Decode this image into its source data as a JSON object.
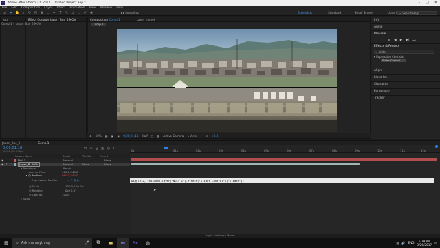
{
  "window": {
    "title": "Adobe After Effects CC 2017 - Untitled Project.aep *",
    "app_icon": "Ae"
  },
  "menu": [
    "File",
    "Edit",
    "Composition",
    "Layer",
    "Effect",
    "Animation",
    "View",
    "Window",
    "Help"
  ],
  "toolbar": {
    "snapping_label": "Snapping"
  },
  "workspaces": [
    "Essentials",
    "Standard",
    "Small Screen",
    "Libraries"
  ],
  "search_help": {
    "placeholder": "Search Help"
  },
  "left_panel": {
    "tab_project": "ject",
    "tab_effect_controls": "Effect Controls",
    "effect_controls_file": "Japan_Bus_6.MOV",
    "breadcrumb": "Comp 1 • Japan_Bus_6.MOV"
  },
  "comp_panel": {
    "tab_composition": "Composition",
    "comp_name": "Comp 1",
    "tab_layer": "Layer (none)",
    "breadcrumb": "Comp 1"
  },
  "viewer_footer": {
    "zoom": "50%",
    "timecode": "0;00;01;18",
    "resolution": "Half",
    "camera": "Active Camera",
    "views": "1 View",
    "exposure": "+0.0"
  },
  "right_panel": {
    "info": "Info",
    "audio": "Audio",
    "preview": "Preview",
    "effects_presets": "Effects & Presets",
    "search_value": "slider",
    "category": "Expression Controls",
    "slider_item": "Slider Control",
    "align": "Align",
    "libraries": "Libraries",
    "character": "Character",
    "paragraph": "Paragraph",
    "tracker": "Tracker"
  },
  "timeline": {
    "tab_item": "Japan_Bus_6",
    "tab_comp": "Comp 1",
    "timecode": "0;00;01;18",
    "frame_info": "00048 (29.97 fps)",
    "columns": {
      "source_name": "Source Name",
      "mode": "Mode",
      "trkmat": "TrkMat",
      "parent": "Parent"
    },
    "layers": [
      {
        "num": "1",
        "name": "Null 1",
        "mode": "Normal",
        "parent": "None"
      },
      {
        "num": "2",
        "name": "Japan_B...MOV",
        "mode": "Normal",
        "trkmat": "None",
        "parent": "None"
      }
    ],
    "props": {
      "transform": "Transform",
      "reset": "Reset",
      "anchor_point": "Anchor Point",
      "anchor_value": "960.0,540.0",
      "position": "Position",
      "position_value": "960.0,540.0",
      "expression_label": "Expression: Position",
      "scale": "Scale",
      "scale_value": "100.0,100.0%",
      "rotation": "Rotation",
      "rotation_value": "0x+0.0°",
      "opacity": "Opacity",
      "opacity_value": "100%",
      "audio": "Audio"
    },
    "ruler_labels": [
      "0s",
      "01s",
      "02s",
      "03s",
      "04s",
      "05s",
      "06s",
      "07s",
      "08s",
      "09s",
      "10s",
      "11s",
      "12s"
    ],
    "expression_text": "wiggle(2, thisComp.layer(\"Null 1\").effect(\"Slider Control\")(\"Slider\"))",
    "footer": "Toggle Switches / Modes"
  },
  "taskbar": {
    "search_placeholder": "Ask me anything",
    "language": "ENG",
    "time": "5:39 PM",
    "date": "3/26/2017"
  },
  "colors": {
    "accent": "#2b84e5",
    "layer1_bar": "#b24d4d",
    "layer2_bar": "#9fb6b3"
  }
}
